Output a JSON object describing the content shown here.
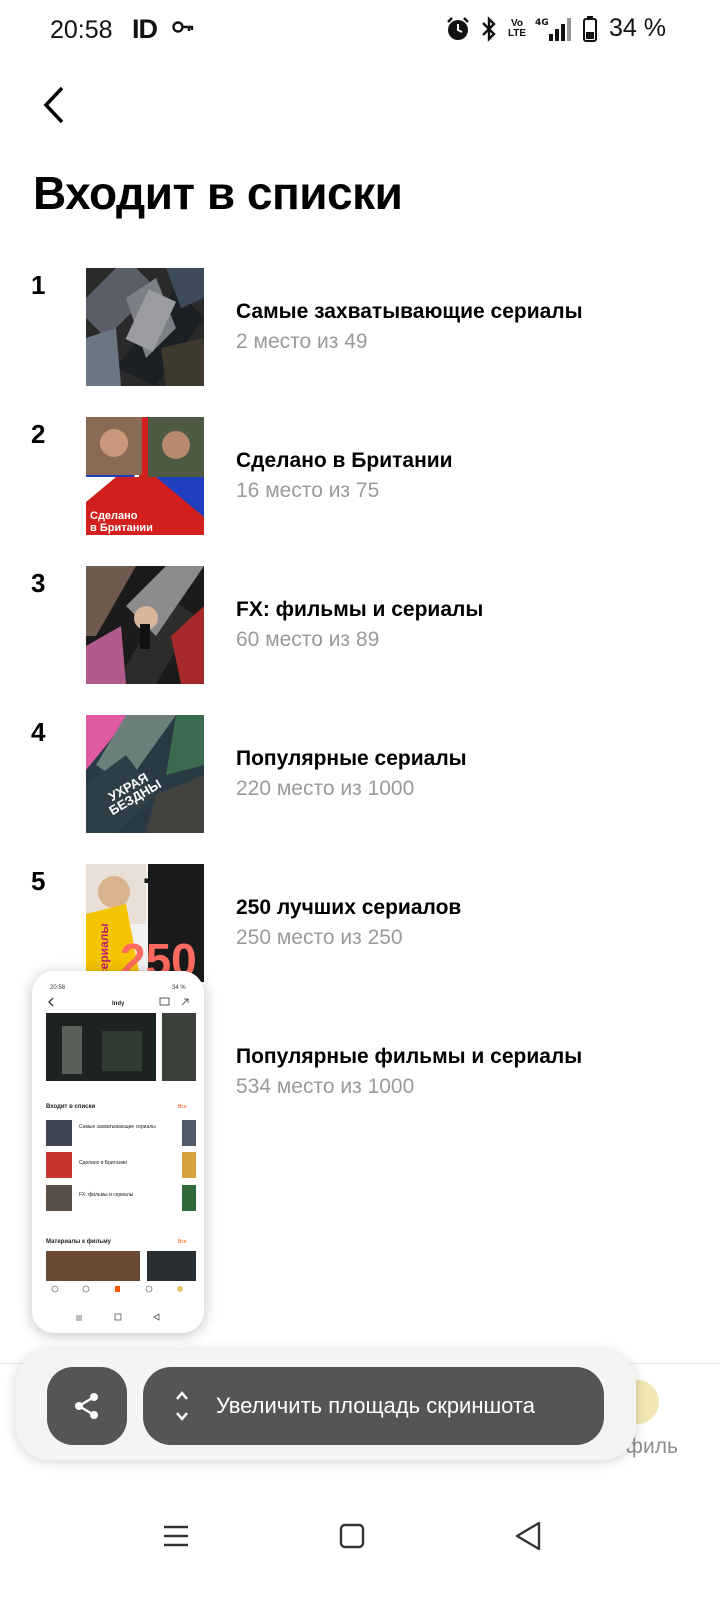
{
  "status_bar": {
    "time": "20:58",
    "carrier_icon": "ID",
    "key_icon": "key-icon",
    "volte": "Vo LTE",
    "network": "4G",
    "battery": "34 %"
  },
  "header": {
    "back_icon": "chevron-left-icon",
    "title": "Входит в списки"
  },
  "lists": [
    {
      "rank": "1",
      "title": "Самые захватывающие сериалы",
      "position": "2 место из 49"
    },
    {
      "rank": "2",
      "title": "Сделано в Британии",
      "position": "16 место из 75",
      "thumb_caption_1": "Сделано",
      "thumb_caption_2": "в Британии"
    },
    {
      "rank": "3",
      "title": "FX: фильмы и сериалы",
      "position": "60 место из 89"
    },
    {
      "rank": "4",
      "title": "Популярные сериалы",
      "position": "220 место из 1000",
      "thumb_caption_1": "УХРАЯ",
      "thumb_caption_2": "БЕЗДНЫ"
    },
    {
      "rank": "5",
      "title": "250 лучших сериалов",
      "position": "250 место из 250",
      "thumb_caption_1": "ТОП",
      "thumb_caption_2": "250",
      "thumb_caption_3": "сериалы"
    },
    {
      "rank": "",
      "title": "Популярные фильмы и сериалы",
      "position": "534 место из 1000"
    }
  ],
  "bottom_tab": {
    "profile_label": "офиль"
  },
  "screenshot_toolbar": {
    "share_icon": "share-icon",
    "expand_label": "Увеличить площадь скриншота"
  },
  "preview": {
    "header_title": "Indy",
    "section_1": "Входит в списки",
    "section_1_all": "Все",
    "items": [
      "Самые захватывающие сериалы",
      "Сделано в Британии",
      "FX: фильмы и сериалы"
    ],
    "section_2": "Материалы к фильму",
    "section_2_all": "Все"
  },
  "colors": {
    "accent": "#ff5500",
    "muted_text": "#9a9a9a",
    "toolbar_button": "#555555"
  }
}
